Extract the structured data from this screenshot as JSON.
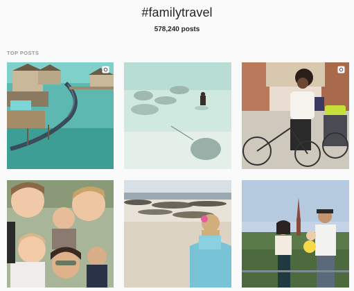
{
  "header": {
    "hashtag": "#familytravel",
    "post_count": "578,240 posts"
  },
  "section": {
    "label": "TOP POSTS"
  },
  "posts": [
    {
      "subject": "overwater-villas",
      "badge": "carousel-icon"
    },
    {
      "subject": "stingrays-shallow-water",
      "badge": ""
    },
    {
      "subject": "family-biking",
      "badge": "carousel-icon"
    },
    {
      "subject": "family-selfie",
      "badge": ""
    },
    {
      "subject": "girl-on-beach",
      "badge": ""
    },
    {
      "subject": "couple-with-baby",
      "badge": ""
    }
  ],
  "colors": {
    "background": "#fafafa",
    "text": "#262626",
    "muted": "#999999"
  }
}
